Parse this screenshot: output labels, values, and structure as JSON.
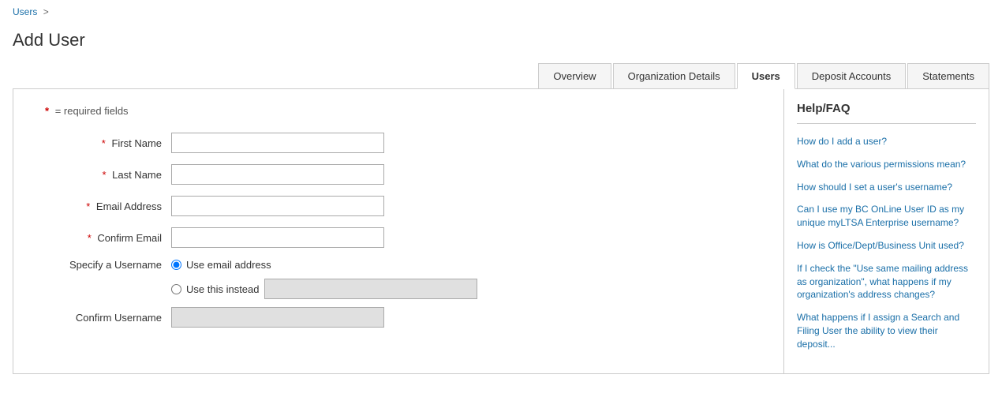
{
  "breadcrumb": {
    "users_label": "Users",
    "separator": ">"
  },
  "page": {
    "title": "Add User"
  },
  "tabs": [
    {
      "id": "overview",
      "label": "Overview",
      "active": false
    },
    {
      "id": "org-details",
      "label": "Organization Details",
      "active": false
    },
    {
      "id": "users",
      "label": "Users",
      "active": true
    },
    {
      "id": "deposit-accounts",
      "label": "Deposit Accounts",
      "active": false
    },
    {
      "id": "statements",
      "label": "Statements",
      "active": false
    }
  ],
  "form": {
    "required_note": "= required fields",
    "fields": {
      "first_name": {
        "label": "First Name",
        "placeholder": "",
        "required": true
      },
      "last_name": {
        "label": "Last Name",
        "placeholder": "",
        "required": true
      },
      "email_address": {
        "label": "Email Address",
        "placeholder": "",
        "required": true
      },
      "confirm_email": {
        "label": "Confirm Email",
        "placeholder": "",
        "required": true
      }
    },
    "username": {
      "section_label": "Specify a Username",
      "option_email": "Use email address",
      "option_custom": "Use this instead",
      "confirm_label": "Confirm Username"
    }
  },
  "sidebar": {
    "title": "Help/FAQ",
    "links": [
      {
        "text": "How do I add a user?"
      },
      {
        "text": "What do the various permissions mean?"
      },
      {
        "text": "How should I set a user's username?"
      },
      {
        "text": "Can I use my BC OnLine User ID as my unique myLTSA Enterprise username?"
      },
      {
        "text": "How is Office/Dept/Business Unit used?"
      },
      {
        "text": "If I check the \"Use same mailing address as organization\", what happens if my organization's address changes?"
      },
      {
        "text": "What happens if I assign a Search and Filing User the ability to view their deposit..."
      }
    ]
  }
}
